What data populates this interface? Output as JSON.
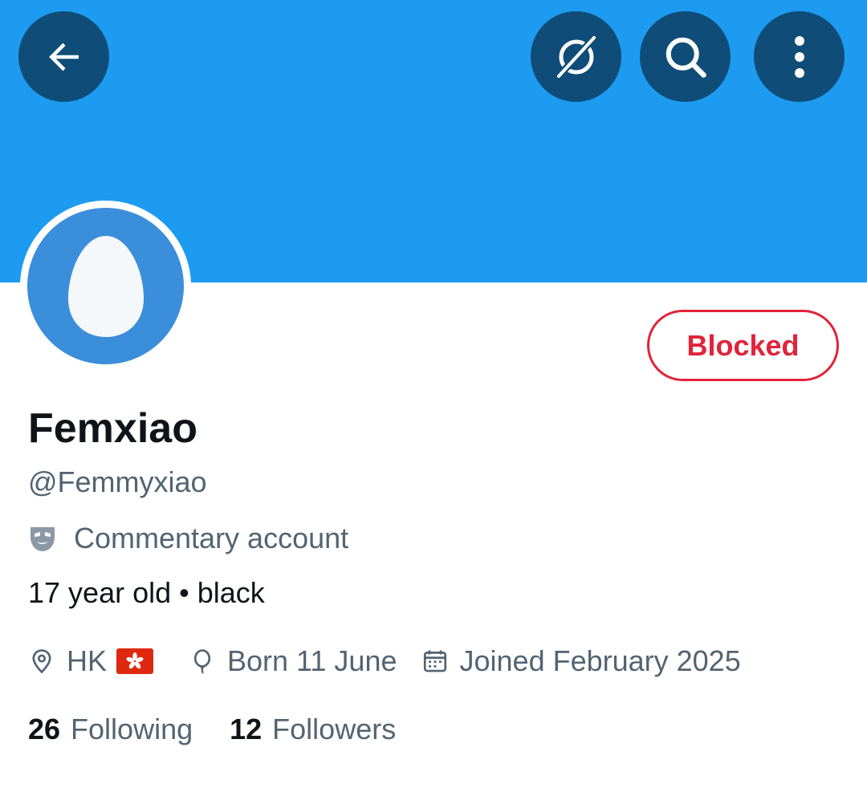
{
  "header": {
    "back_icon": "arrow-left-icon",
    "grok_icon": "grok-icon",
    "search_icon": "search-icon",
    "more_icon": "more-vertical-icon",
    "banner_color": "#1d9bf0",
    "button_color": "#0f4d78"
  },
  "profile": {
    "avatar_icon": "default-egg-avatar",
    "blocked_label": "Blocked",
    "blocked_color": "#e0243a",
    "display_name": "Femxiao",
    "handle": "@Femmyxiao",
    "account_label": "Commentary account",
    "account_label_icon": "parody-mask-icon",
    "bio": "17 year old • black",
    "location": "HK",
    "location_icon": "location-pin-icon",
    "flag_icon": "hong-kong-flag",
    "birthday": "Born 11 June",
    "birthday_icon": "balloon-icon",
    "joined": "Joined February 2025",
    "joined_icon": "calendar-icon"
  },
  "stats": {
    "following_count": "26",
    "following_label": "Following",
    "followers_count": "12",
    "followers_label": "Followers"
  }
}
